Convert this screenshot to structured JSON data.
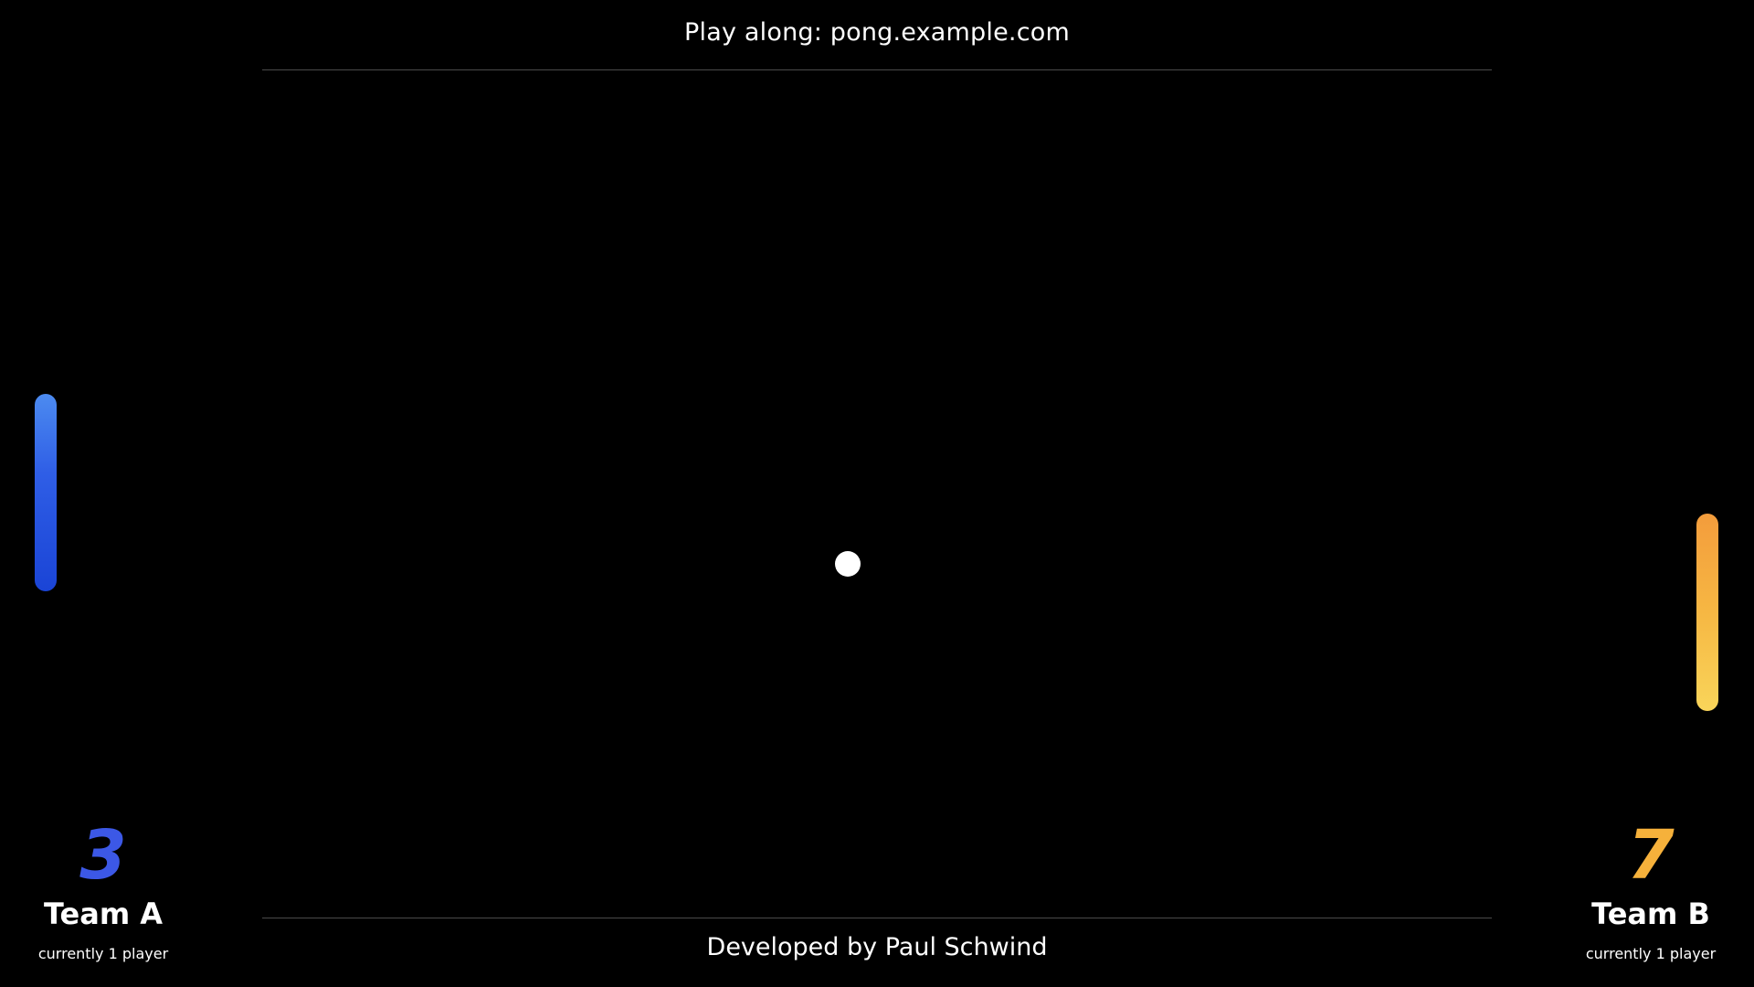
{
  "header": {
    "text": "Play along: pong.example.com"
  },
  "footer": {
    "text": "Developed by Paul Schwind"
  },
  "teams": [
    {
      "score": "3",
      "name": "Team A",
      "players": "currently 1 player",
      "color": "#3c58e6"
    },
    {
      "score": "7",
      "name": "Team B",
      "players": "currently 1 player",
      "color": "#f6b13b"
    }
  ],
  "colors": {
    "background": "#000000",
    "left_paddle_gradient": [
      "#4c8bf0",
      "#1a44d6"
    ],
    "right_paddle_gradient": [
      "#f39c3c",
      "#f9d55a"
    ],
    "ball": "#ffffff"
  }
}
